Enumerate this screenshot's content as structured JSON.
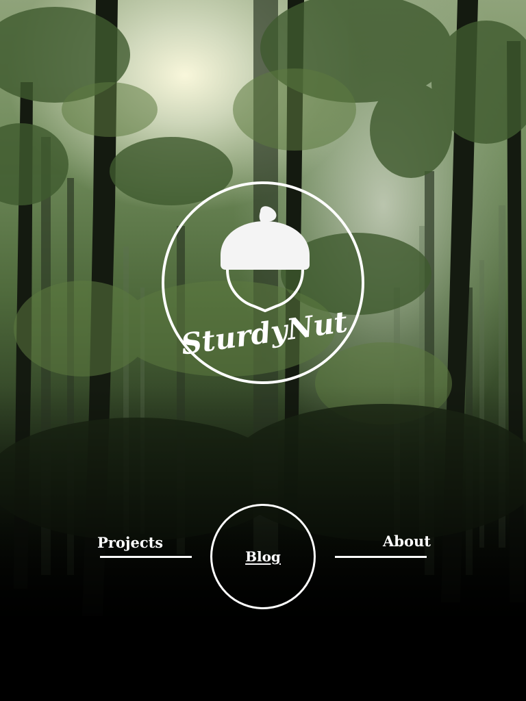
{
  "brand": {
    "name": "SturdyNut"
  },
  "nav": {
    "projects_label": "Projects",
    "blog_label": "Blog",
    "about_label": "About"
  },
  "colors": {
    "foreground": "#ffffff",
    "background_bottom": "#000000",
    "foliage": "#4f6a3c"
  },
  "icons": {
    "logo": "acorn-icon"
  }
}
